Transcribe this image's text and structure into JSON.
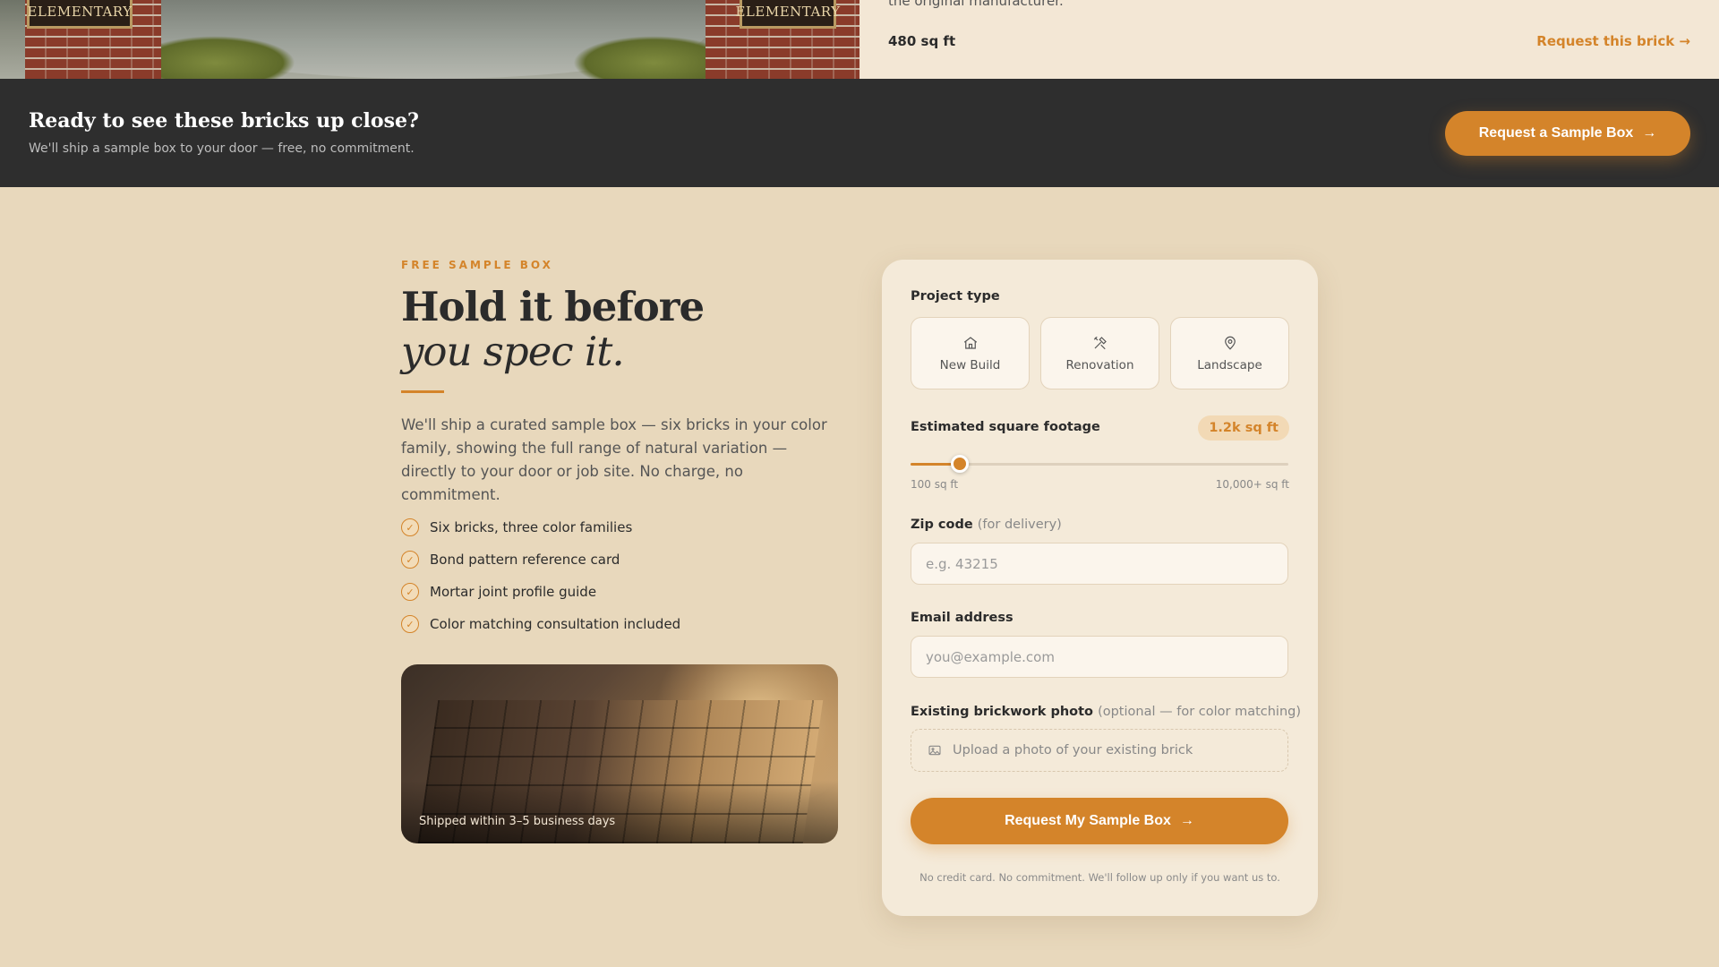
{
  "hero": {
    "plaque_left": "ELEMENTARY",
    "plaque_right": "ELEMENTARY"
  },
  "spec": {
    "cut_text": "the original manufacturer.",
    "area": "480 sq ft",
    "request_link": "Request this brick",
    "request_arrow": "→"
  },
  "band": {
    "title": "Ready to see these bricks up close?",
    "subtitle": "We'll ship a sample box to your door — free, no commitment.",
    "cta_label": "Request a Sample Box",
    "cta_arrow": "→"
  },
  "intro": {
    "eyebrow": "FREE SAMPLE BOX",
    "heading_line1": "Hold it before",
    "heading_line2": "you spec it.",
    "lead": "We'll ship a curated sample box — six bricks in your color family, showing the full range of natural variation — directly to your door or job site. No charge, no commitment.",
    "features": [
      "Six bricks, three color families",
      "Bond pattern reference card",
      "Mortar joint profile guide",
      "Color matching consultation included"
    ],
    "photo_caption": "Shipped within 3–5 business days"
  },
  "form": {
    "project_type_label": "Project type",
    "project_types": [
      {
        "label": "New Build",
        "icon": "home-icon"
      },
      {
        "label": "Renovation",
        "icon": "tools-icon"
      },
      {
        "label": "Landscape",
        "icon": "map-pin-icon"
      }
    ],
    "sqft_label": "Estimated square footage",
    "sqft_value": "1.2k sq ft",
    "slider_fraction": 0.13,
    "slider_min": "100 sq ft",
    "slider_max": "10,000+ sq ft",
    "zip_label": "Zip code",
    "zip_hint": "(for delivery)",
    "zip_placeholder": "e.g. 43215",
    "email_label": "Email address",
    "email_placeholder": "you@example.com",
    "photo_label": "Existing brickwork photo",
    "photo_hint": "(optional — for color matching)",
    "upload_text": "Upload a photo of your existing brick",
    "submit_label": "Request My Sample Box",
    "submit_arrow": "→",
    "fine_print": "No credit card. No commitment. We'll follow up only if you want us to."
  },
  "colors": {
    "accent": "#d4842a",
    "page_bg": "#e8d8bc",
    "band_bg": "#2e2e2e",
    "card_bg": "#f4ead9"
  }
}
